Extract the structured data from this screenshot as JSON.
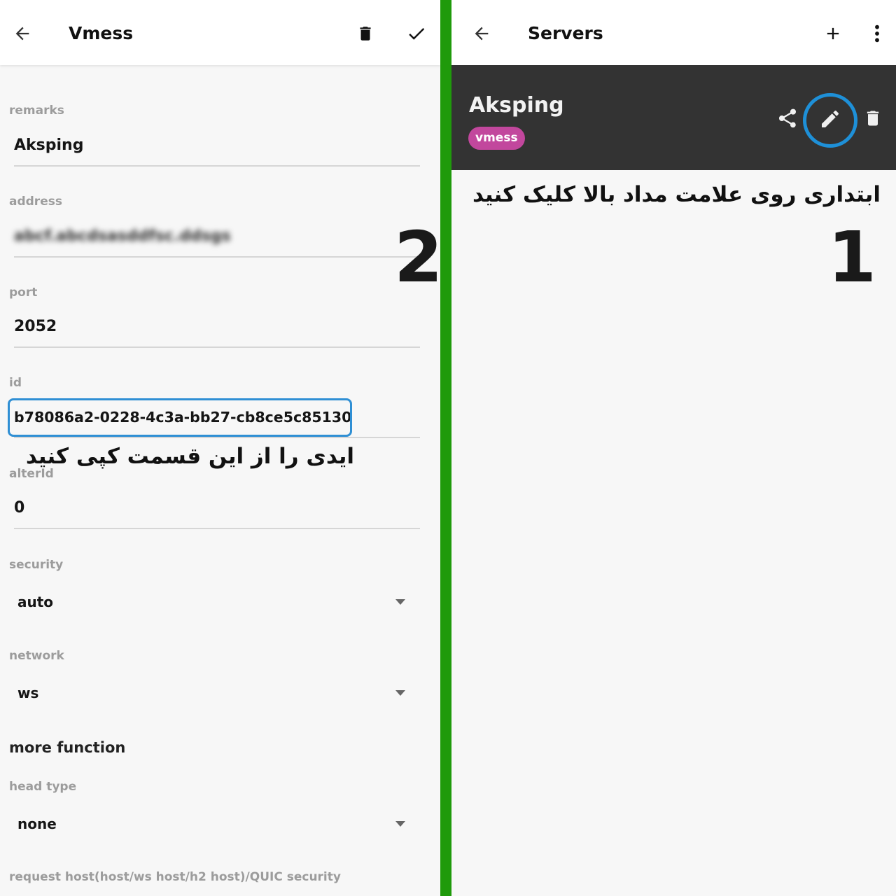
{
  "left": {
    "title": "Vmess",
    "icons": {
      "back": "arrow-left-icon",
      "delete": "trash-icon",
      "confirm": "check-icon"
    },
    "fields": {
      "remarks": {
        "label": "remarks",
        "value": "Aksping"
      },
      "address": {
        "label": "address",
        "value": "abcf.abcdsasddfsc.ddsgs"
      },
      "port": {
        "label": "port",
        "value": "2052"
      },
      "id": {
        "label": "id",
        "value": "b78086a2-0228-4c3a-bb27-cb8ce5c85130"
      },
      "alterId": {
        "label": "alterId",
        "value": "0"
      },
      "security": {
        "label": "security",
        "value": "auto"
      },
      "network": {
        "label": "network",
        "value": "ws"
      },
      "head_type": {
        "label": "head type",
        "value": "none"
      },
      "request_host": {
        "label": "request host(host/ws host/h2 host)/QUIC security"
      }
    },
    "section_more": "more function",
    "annotation_text": "ایدی را از این قسمت کپی کنید",
    "step_number": "2"
  },
  "right": {
    "title": "Servers",
    "icons": {
      "back": "arrow-left-icon",
      "add": "plus-icon",
      "menu": "more-vert-icon",
      "share": "share-icon",
      "edit": "pencil-icon",
      "delete": "trash-icon"
    },
    "server": {
      "name": "Aksping",
      "type": "vmess"
    },
    "annotation_text": "ابتداری روی علامت مداد بالا کلیک کنید",
    "step_number": "1"
  },
  "colors": {
    "divider": "#1f9a0b",
    "highlight": "#2f8fd4",
    "badge": "#c2479d",
    "card": "#333333"
  }
}
